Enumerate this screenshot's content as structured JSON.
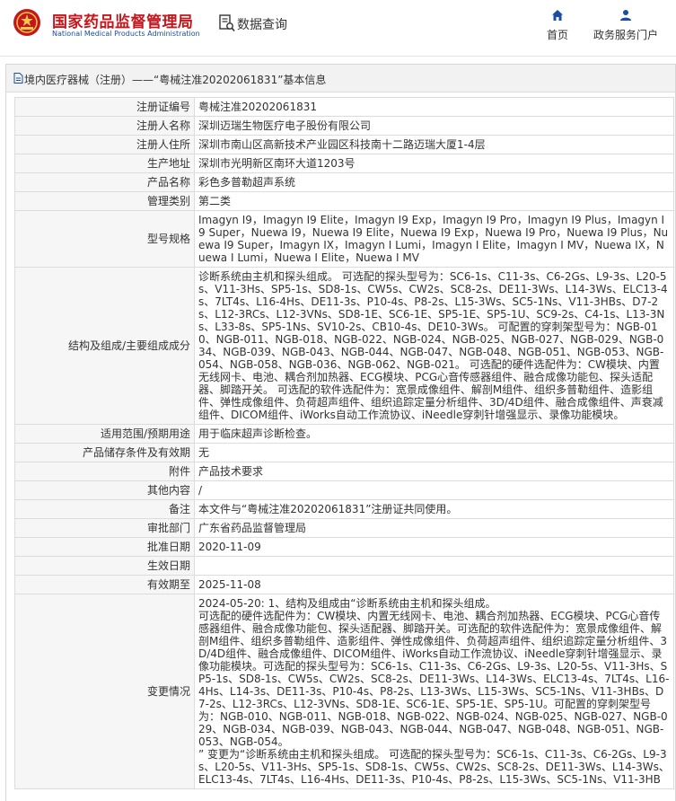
{
  "header": {
    "logo_cn": "国家药品监督管理局",
    "logo_en": "National Medical Products Administration",
    "query_label": "数据查询",
    "nav": [
      {
        "label": "首页",
        "icon": "home-icon"
      },
      {
        "label": "政务服务门户",
        "icon": "user-icon"
      }
    ]
  },
  "colors": {
    "brand_red": "#c4161c",
    "brand_blue": "#1a4ea0",
    "nav_blue": "#1a4ea0"
  },
  "record": {
    "breadcrumb": "境内医疗器械（注册）——“粤械注准20202061831”基本信息",
    "rows": [
      {
        "label": "注册证编号",
        "value": "粤械注准20202061831"
      },
      {
        "label": "注册人名称",
        "value": "深圳迈瑞生物医疗电子股份有限公司"
      },
      {
        "label": "注册人住所",
        "value": "深圳市南山区高新技术产业园区科技南十二路迈瑞大厦1-4层"
      },
      {
        "label": "生产地址",
        "value": "深圳市光明新区南环大道1203号"
      },
      {
        "label": "产品名称",
        "value": "彩色多普勒超声系统"
      },
      {
        "label": "管理类别",
        "value": "第二类"
      },
      {
        "label": "型号规格",
        "value": "Imagyn I9，Imagyn I9 Elite，Imagyn I9 Exp，Imagyn I9 Pro，Imagyn I9 Plus，Imagyn I9 Super，Nuewa I9，Nuewa I9 Elite，Nuewa I9 Exp，Nuewa I9 Pro，Nuewa I9 Plus，Nuewa I9 Super，Imagyn IX，Imagyn I Lumi，Imagyn I Elite，Imagyn I MV，Nuewa IX，Nuewa I Lumi，Nuewa I Elite，Nuewa I MV"
      },
      {
        "label": "结构及组成/主要组成成分",
        "value": "诊断系统由主机和探头组成。 可选配的探头型号为：SC6-1s、C11-3s、C6-2Gs、L9-3s、L20-5s、V11-3Hs、SP5-1s、SD8-1s、CW5s、CW2s、SC8-2s、DE11-3Ws、L14-3Ws、ELC13-4s、7LT4s、L16-4Hs、DE11-3s、P10-4s、P8-2s、L15-3Ws、SC5-1Ns、V11-3HBs、D7-2s、L12-3RCs、L12-3VNs、SD8-1E、SC6-1E、SP5-1E、SP5-1U、SC9-2s、C4-1s、L13-3Ns、L33-8s、SP5-1Ns、SV10-2s、CB10-4s、DE10-3Ws。 可配置的穿刺架型号为：NGB-010、NGB-011、NGB-018、NGB-022、NGB-024、NGB-025、NGB-027、NGB-029、NGB-034、NGB-039、NGB-043、NGB-044、NGB-047、NGB-048、NGB-051、NGB-053、NGB-054、NGB-058、NGB-036、NGB-062、NGB-021。 可选配的硬件选配件为：CW模块、内置无线网卡、电池、耦合剂加热器、ECG模块、PCG心音传感器组件、融合成像功能包、探头适配器、脚踏开关。 可选配的软件选配件为：宽景成像组件、解剖M组件、组织多普勒组件、造影组件、弹性成像组件、负荷超声组件、组织追踪定量分析组件、3D/4D组件、融合成像组件、声衰减组件、DICOM组件、iWorks自动工作流协议、iNeedle穿刺针增强显示、录像功能模块。"
      },
      {
        "label": "适用范围/预期用途",
        "value": "用于临床超声诊断检查。"
      },
      {
        "label": "产品储存条件及有效期",
        "value": "无"
      },
      {
        "label": "附件",
        "value": "产品技术要求"
      },
      {
        "label": "其他内容",
        "value": "/"
      },
      {
        "label": "备注",
        "value": "本文件与“粤械注准20202061831”注册证共同使用。"
      },
      {
        "label": "审批部门",
        "value": "广东省药品监督管理局"
      },
      {
        "label": "批准日期",
        "value": "2020-11-09"
      },
      {
        "label": "生效日期",
        "value": ""
      },
      {
        "label": "有效期至",
        "value": "2025-11-08"
      },
      {
        "label": "变更情况",
        "value": "2024-05-20: 1、结构及组成由“诊断系统由主机和探头组成。\n可选配的硬件选配件为：CW模块、内置无线网卡、电池、耦合剂加热器、ECG模块、PCG心音传感器组件、融合成像功能包、探头适配器、脚踏开关。可选配的软件选配件为：宽景成像组件、解剖M组件、组织多普勒组件、造影组件、弹性成像组件、负荷超声组件、组织追踪定量分析组件、3D/4D组件、融合成像组件、DICOM组件、iWorks自动工作流协议、iNeedle穿刺针增强显示、录像功能模块。可选配的探头型号为：SC6-1s、C11-3s、C6-2Gs、L9-3s、L20-5s、V11-3Hs、SP5-1s、SD8-1s、CW5s、CW2s、SC8-2s、DE11-3Ws、L14-3Ws、ELC13-4s、7LT4s、L16-4Hs、L14-3s、DE11-3s、P10-4s、P8-2s、L13-3Ws、L15-3Ws、SC5-1Ns、V11-3HBs、D7-2s、L12-3RCs、L12-3VNs、SD8-1E、SC6-1E、SP5-1E、SP5-1U。可配置的穿刺架型号为：NGB-010、NGB-011、NGB-018、NGB-022、NGB-024、NGB-025、NGB-027、NGB-029、NGB-034、NGB-039、NGB-043、NGB-044、NGB-047、NGB-048、NGB-051、NGB-053、NGB-054。\n” 变更为“诊断系统由主机和探头组成。 可选配的探头型号为：SC6-1s、C11-3s、C6-2Gs、L9-3s、L20-5s、V11-3Hs、SP5-1s、SD8-1s、CW5s、CW2s、SC8-2s、DE11-3Ws、L14-3Ws、ELC13-4s、7LT4s、L16-4Hs、DE11-3s、P10-4s、P8-2s、L15-3Ws、SC5-1Ns、V11-3HB"
      }
    ]
  }
}
